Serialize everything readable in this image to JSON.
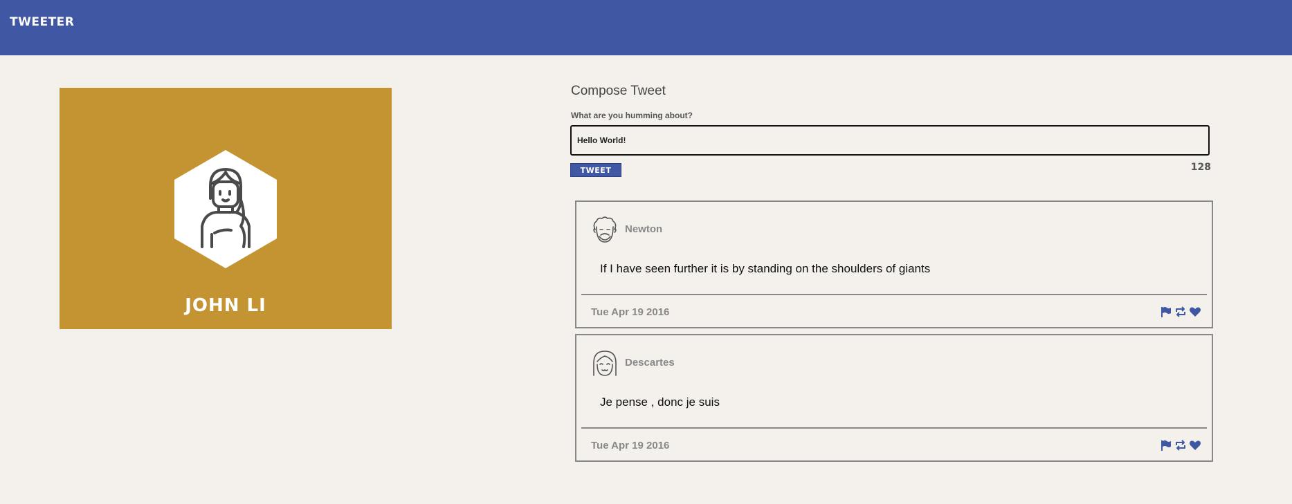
{
  "navbar": {
    "brand": "TWEETER"
  },
  "profile": {
    "name": "JOHN LI"
  },
  "compose": {
    "title": "Compose Tweet",
    "label": "What are you humming about?",
    "input_value": "Hello World!",
    "button_label": "TWEET",
    "char_count": "128"
  },
  "tweets": [
    {
      "author": "Newton",
      "content": "If I have seen further it is by standing on the shoulders of giants",
      "date": "Tue Apr 19 2016"
    },
    {
      "author": "Descartes",
      "content": "Je pense , donc je suis",
      "date": "Tue Apr 19 2016"
    }
  ],
  "colors": {
    "navbar": "#4057a3",
    "profile_card": "#c49433",
    "background": "#f4f1ec",
    "action_icons": "#4057a3"
  },
  "icons": [
    "flag-icon",
    "retweet-icon",
    "heart-icon"
  ]
}
